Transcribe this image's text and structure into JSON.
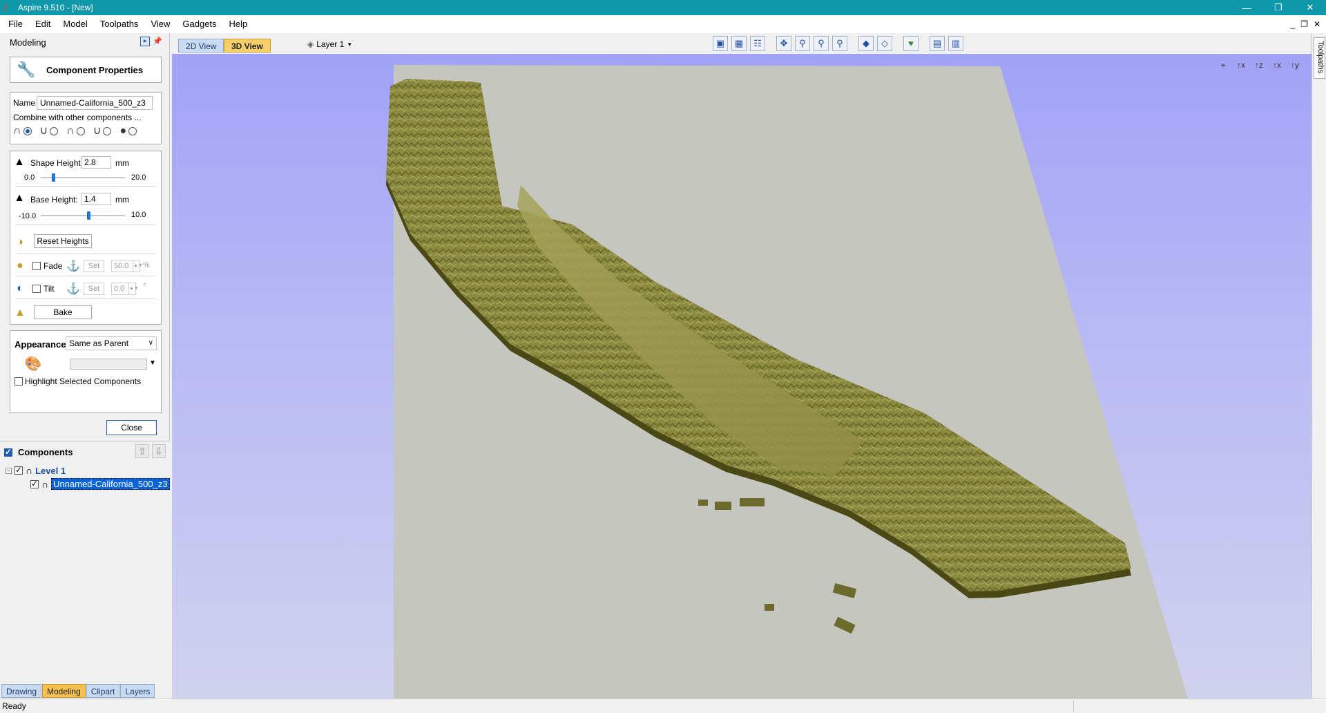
{
  "window": {
    "title": "Aspire 9.510 - [New]",
    "minimize": "—",
    "maximize": "❐",
    "close": "✕"
  },
  "menu": [
    "File",
    "Edit",
    "Model",
    "Toolpaths",
    "View",
    "Gadgets",
    "Help"
  ],
  "mdi_buttons": {
    "minimize": "_",
    "restore": "❐",
    "close": "✕"
  },
  "left_panel": {
    "header": "Modeling",
    "component_properties": "Component Properties",
    "name_label": "Name",
    "name_value": "Unnamed-California_500_z3",
    "combine_label": "Combine with other components ...",
    "shape_height_label": "Shape Height:",
    "shape_height_value": "2.8",
    "shape_height_unit": "mm",
    "shape_height_min": "0.0",
    "shape_height_max": "20.0",
    "shape_height_fraction": 0.14,
    "base_height_label": "Base Height:",
    "base_height_value": "1.4",
    "base_height_unit": "mm",
    "base_height_min": "-10.0",
    "base_height_max": "10.0",
    "base_height_fraction": 0.57,
    "reset_heights": "Reset Heights",
    "fade_label": "Fade",
    "fade_set": "Set",
    "fade_value": "50.0",
    "fade_unit": "%",
    "tilt_label": "Tilt",
    "tilt_set": "Set",
    "tilt_value": "0.0",
    "tilt_unit": "°",
    "bake": "Bake",
    "appearance_label": "Appearance",
    "appearance_value": "Same as Parent",
    "highlight_label": "Highlight Selected Components",
    "close": "Close"
  },
  "components": {
    "title": "Components",
    "level": "Level 1",
    "item": "Unnamed-California_500_z3"
  },
  "bottom_tabs": [
    {
      "label": "Drawing",
      "active": false
    },
    {
      "label": "Modeling",
      "active": true
    },
    {
      "label": "Clipart",
      "active": false
    },
    {
      "label": "Layers",
      "active": false
    }
  ],
  "view_tabs": {
    "tab_2d": "2D View",
    "tab_3d": "3D View",
    "layer": "Layer 1"
  },
  "corner_tools": [
    "⌖",
    "↑x",
    "↑z",
    "↑x",
    "↑y"
  ],
  "right_strip": "Toolpaths",
  "status": "Ready",
  "colors": {
    "titlebar": "#0f98a9",
    "terrain": "#8c8a40",
    "plane": "#c6c6c0",
    "viewport_top": "#a2a2f6"
  }
}
